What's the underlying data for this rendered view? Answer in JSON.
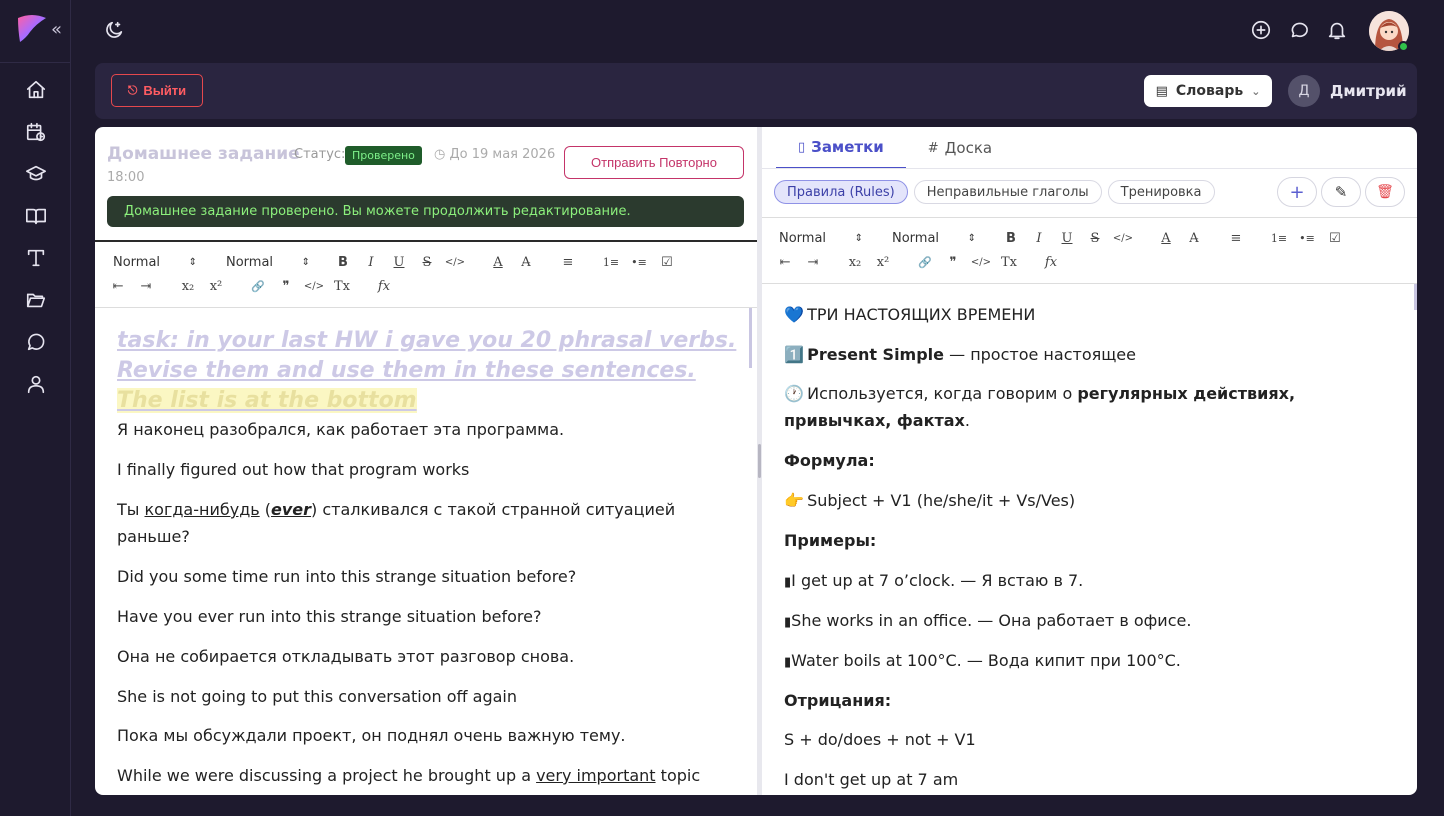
{
  "sidebar": {
    "collapse_icon": "chevrons-left-icon",
    "items": [
      {
        "icon": "home-icon"
      },
      {
        "icon": "calendar-clock-icon"
      },
      {
        "icon": "graduation-cap-icon"
      },
      {
        "icon": "book-open-icon"
      },
      {
        "icon": "text-tool-icon"
      },
      {
        "icon": "folder-open-icon"
      },
      {
        "icon": "chat-icon"
      },
      {
        "icon": "user-icon"
      }
    ]
  },
  "topbar": {
    "theme_icon": "moon-stars-icon",
    "icons": [
      "plus-circle-icon",
      "message-icon",
      "bell-icon"
    ],
    "online_color": "#31c24a"
  },
  "actionbar": {
    "logout_label": "Выйти",
    "dictionary_label": "Словарь",
    "user_initial": "Д",
    "user_name": "Дмитрий"
  },
  "homework": {
    "title": "Домашнее задание",
    "status_label": "Статус:",
    "status_value": "Проверено",
    "due": "До 19 мая 2026",
    "due_time": "18:00",
    "resend_label": "Отправить Повторно",
    "notice": "Домашнее задание проверено. Вы можете продолжить редактирование."
  },
  "editor_toolbar": {
    "font_select": "Normal",
    "size_select": "Normal",
    "buttons_row1": [
      "B",
      "I",
      "U",
      "S",
      "</>",
      "A",
      "A̶",
      "≡",
      "1≡",
      "•≡",
      "☑"
    ],
    "buttons_row2": [
      "⇤",
      "⇥",
      "x₂",
      "x²",
      "🔗",
      "❞",
      "</>",
      "Tx",
      "fx"
    ]
  },
  "left_doc": {
    "task_part1": "task: in your last HW i gave you 20 phrasal verbs. Revise them and use them in these sentences.",
    "task_highlight": "The list is at the bottom",
    "lines": [
      "Я наконец разобрался, как работает эта программа.",
      "I finally figured out how that program works",
      "Ты когда-нибудь (ever) сталкивался с такой странной ситуацией раньше?",
      "Did you some time run into this strange situation before?",
      "Have you ever run into this strange situation before?",
      "Она не собирается откладывать этот разговор снова.",
      "She is not going to put this conversation off again",
      "Пока мы обсуждали проект, он поднял очень важную тему.",
      "While we were discussing a project he brought up a very important topic"
    ],
    "line3_pre": "Ты ",
    "line3_u": "когда-нибудь",
    "line3_paren_open": " (",
    "line3_ever": "ever",
    "line3_post": ") сталкивался с такой странной ситуацией раньше?",
    "line9_pre": "While we were discussing a project he brought up a ",
    "line9_u": "very important",
    "line9_post": " topic"
  },
  "right_panel": {
    "tabs": [
      {
        "label": "Заметки",
        "icon": "note-icon"
      },
      {
        "label": "Доска",
        "icon": "hash-icon"
      }
    ],
    "chips": [
      "Правила (Rules)",
      "Неправильные глаголы",
      "Тренировка"
    ],
    "actions": [
      "+",
      "✎",
      "🗑"
    ]
  },
  "notes": {
    "h1": "ТРИ НАСТОЯЩИХ ВРЕМЕНИ",
    "h1_emoji": "💙",
    "ps_emoji": "1️⃣",
    "ps_bold": "Present Simple",
    "ps_rest": " — простое настоящее",
    "use_emoji": "🕐",
    "use_pre": "Используется, когда говорим о ",
    "use_bold": "регулярных действиях, привычках, фактах",
    "use_post": ".",
    "formula_label": "Формула:",
    "formula_emoji": "👉",
    "formula": "Subject + V1 (he/she/it + Vs/Ves)",
    "examples_label": "Примеры:",
    "examples": [
      "I get up at 7 o’clock. — Я встаю в 7.",
      "She works in an office. — Она работает в офисе.",
      "Water boils at 100°C. — Вода кипит при 100°C."
    ],
    "example_bullet": "▮",
    "negation_label": "Отрицания:",
    "negation_formula": "S + do/does + not + V1",
    "negation_example": "I don't get up at 7 am"
  }
}
